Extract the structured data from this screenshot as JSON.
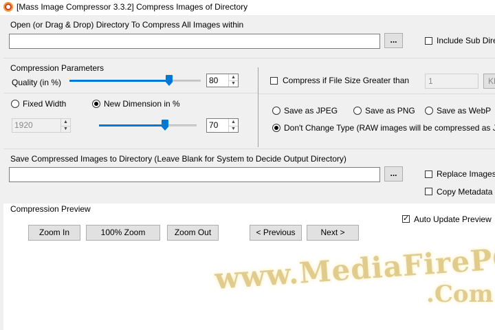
{
  "window": {
    "title": "[Mass Image Compressor 3.3.2] Compress Images of Directory"
  },
  "source": {
    "label": "Open (or Drag & Drop) Directory To Compress All Images within",
    "path_value": "",
    "browse_label": "...",
    "include_sub_label": "Include Sub Direc",
    "include_sub_checked": false
  },
  "params": {
    "title": "Compression Parameters",
    "quality_label": "Quality (in %)",
    "quality_value": "80",
    "fixed_width_label": "Fixed Width",
    "fixed_width_selected": false,
    "new_dimension_label": "New Dimension in %",
    "new_dimension_selected": true,
    "width_value": "1920",
    "dimension_value": "70"
  },
  "size_filter": {
    "label": "Compress if File Size Greater than",
    "checked": false,
    "value": "1",
    "unit_label": "KB"
  },
  "format": {
    "jpeg_label": "Save as JPEG",
    "png_label": "Save as PNG",
    "webp_label": "Save as WebP",
    "keep_label": "Don't Change Type (RAW images will be compressed as JPEG)",
    "selected": "keep"
  },
  "output": {
    "label": "Save Compressed Images to Directory (Leave Blank for System to Decide Output Directory)",
    "path_value": "",
    "browse_label": "...",
    "replace_label": "Replace Images",
    "replace_checked": false,
    "copy_meta_label": "Copy Metadata (",
    "copy_meta_checked": false
  },
  "preview": {
    "title": "Compression Preview",
    "auto_update_label": "Auto Update Preview",
    "auto_update_checked": true,
    "zoom_in_label": "Zoom In",
    "zoom_100_label": "100% Zoom",
    "zoom_out_label": "Zoom Out",
    "previous_label": "< Previous",
    "next_label": "Next >"
  },
  "watermark": {
    "line1": "www.MediaFirePC",
    "line2": ".Com"
  },
  "colors": {
    "accent": "#0078d7",
    "window_bg": "#f0f0f0",
    "app_icon": "#d93a1e"
  }
}
